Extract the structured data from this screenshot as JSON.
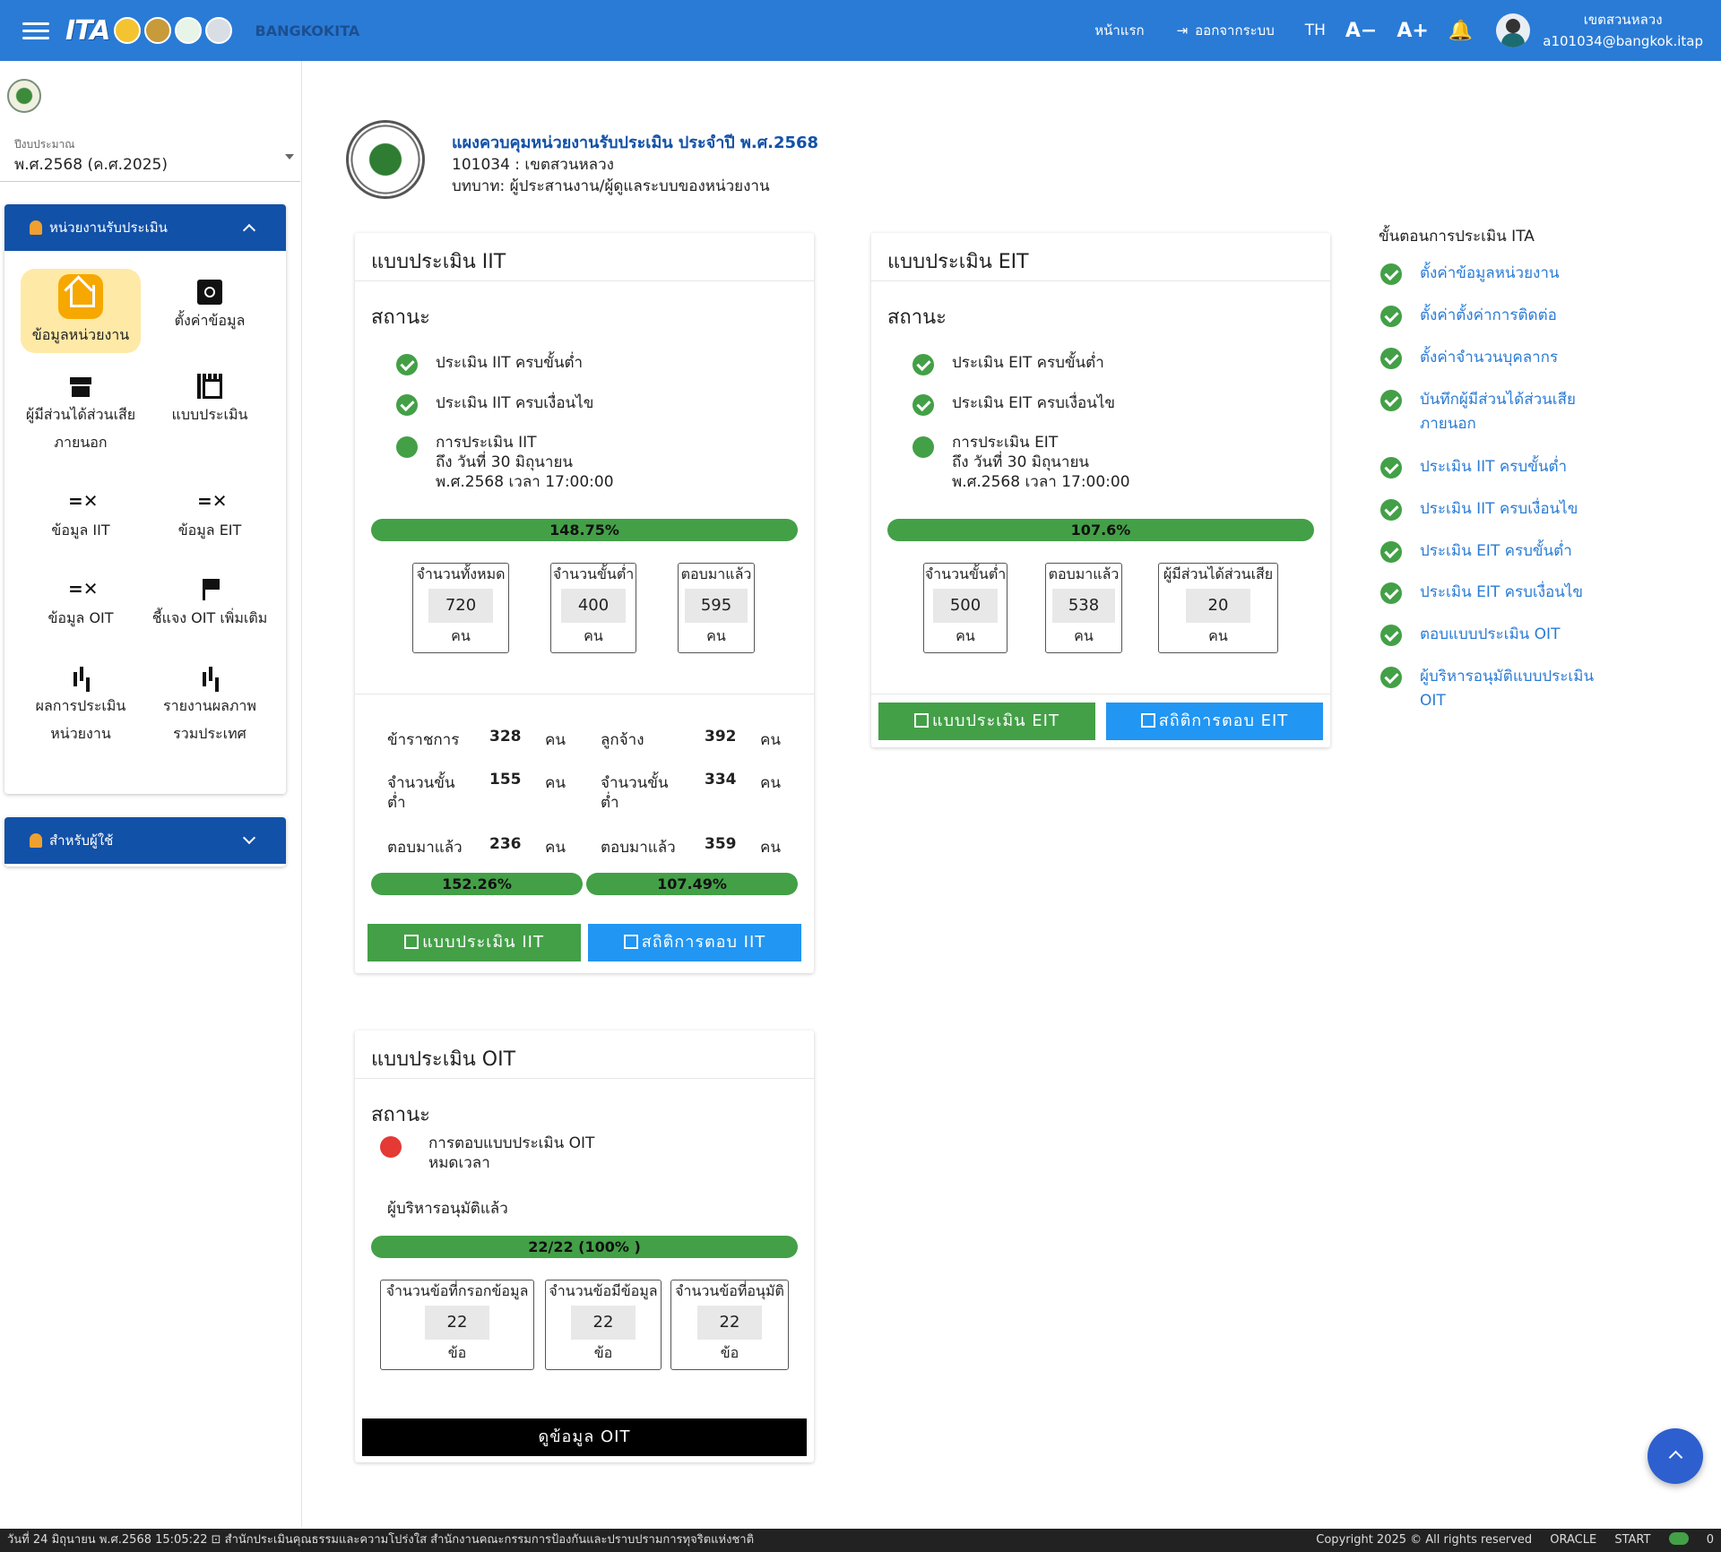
{
  "header": {
    "brand": "BANGKOKITA",
    "home": "หน้าแรก",
    "logout": "ออกจากระบบ",
    "lang": "TH",
    "font_down": "A−",
    "font_up": "A+",
    "user_name": "เขตสวนหลวง",
    "user_email": "a101034@bangkok.itap"
  },
  "sidebar": {
    "budget_label": "ปีงบประมาณ",
    "budget_value": "พ.ศ.2568 (ค.ศ.2025)",
    "panel_title": "หน่วยงานรับประเมิน",
    "items": [
      {
        "line1": "ข้อมูลหน่วยงาน",
        "line2": ""
      },
      {
        "line1": "ตั้งค่าข้อมูล",
        "line2": ""
      },
      {
        "line1": "ผู้มีส่วนได้ส่วนเสีย",
        "line2": "ภายนอก"
      },
      {
        "line1": "แบบประเมิน",
        "line2": ""
      },
      {
        "line1": "ข้อมูล IIT",
        "line2": ""
      },
      {
        "line1": "ข้อมูล EIT",
        "line2": ""
      },
      {
        "line1": "ข้อมูล OIT",
        "line2": ""
      },
      {
        "line1": "ชี้แจง OIT เพิ่มเติม",
        "line2": ""
      },
      {
        "line1": "ผลการประเมิน",
        "line2": "หน่วยงาน"
      },
      {
        "line1": "รายงานผลภาพ",
        "line2": "รวมประเทศ"
      }
    ],
    "user_panel_title": "สำหรับผู้ใช้"
  },
  "org": {
    "title": "แผงควบคุมหน่วยงานรับประเมิน ประจำปี พ.ศ.2568",
    "code": "101034 : เขตสวนหลวง",
    "role": "บทบาท: ผู้ประสานงาน/ผู้ดูแลระบบของหน่วยงาน"
  },
  "iit": {
    "title": "แบบประเมิน IIT",
    "status_label": "สถานะ",
    "s1": "ประเมิน IIT ครบขั้นต่ำ",
    "s2": "ประเมิน IIT ครบเงื่อนไข",
    "s3a": "การประเมิน IIT",
    "s3b": "ถึง วันที่ 30 มิถุนายน",
    "s3c": "พ.ศ.2568 เวลา 17:00:00",
    "progress": "148.75%",
    "boxes": [
      {
        "label": "จำนวนทั้งหมด",
        "value": "720",
        "unit": "คน"
      },
      {
        "label": "จำนวนขั้นต่ำ",
        "value": "400",
        "unit": "คน"
      },
      {
        "label": "ตอบมาแล้ว",
        "value": "595",
        "unit": "คน"
      }
    ],
    "left": {
      "k1": "ข้าราชการ",
      "v1": "328",
      "k2a": "จำนวนขั้น",
      "k2b": "ต่ำ",
      "v2": "155",
      "k3": "ตอบมาแล้ว",
      "v3": "236",
      "unit": "คน",
      "progress": "152.26%"
    },
    "right": {
      "k1": "ลูกจ้าง",
      "v1": "392",
      "k2a": "จำนวนขั้น",
      "k2b": "ต่ำ",
      "v2": "334",
      "k3": "ตอบมาแล้ว",
      "v3": "359",
      "unit": "คน",
      "progress": "107.49%"
    },
    "btn_form": "แบบประเมิน IIT",
    "btn_stats": "สถิติการตอบ IIT"
  },
  "eit": {
    "title": "แบบประเมิน EIT",
    "status_label": "สถานะ",
    "s1": "ประเมิน EIT ครบขั้นต่ำ",
    "s2": "ประเมิน EIT ครบเงื่อนไข",
    "s3a": "การประเมิน EIT",
    "s3b": "ถึง วันที่ 30 มิถุนายน",
    "s3c": "พ.ศ.2568 เวลา 17:00:00",
    "progress": "107.6%",
    "boxes": [
      {
        "label": "จำนวนขั้นต่ำ",
        "value": "500",
        "unit": "คน"
      },
      {
        "label": "ตอบมาแล้ว",
        "value": "538",
        "unit": "คน"
      },
      {
        "label": "ผู้มีส่วนได้ส่วนเสีย",
        "value": "20",
        "unit": "คน"
      }
    ],
    "btn_form": "แบบประเมิน EIT",
    "btn_stats": "สถิติการตอบ EIT"
  },
  "oit": {
    "title": "แบบประเมิน OIT",
    "status_label": "สถานะ",
    "s1a": "การตอบแบบประเมิน OIT",
    "s1b": "หมดเวลา",
    "approved": "ผู้บริหารอนุมัติแล้ว",
    "progress": "22/22 (100% )",
    "boxes": [
      {
        "label": "จำนวนข้อที่กรอกข้อมูล",
        "value": "22",
        "unit": "ข้อ"
      },
      {
        "label": "จำนวนข้อมีข้อมูล",
        "value": "22",
        "unit": "ข้อ"
      },
      {
        "label": "จำนวนข้อที่อนุมัติ",
        "value": "22",
        "unit": "ข้อ"
      }
    ],
    "btn_view": "ดูข้อมูล OIT"
  },
  "steps": {
    "title": "ขั้นตอนการประเมิน ITA",
    "items": [
      {
        "a": "ตั้งค่าข้อมูลหน่วยงาน",
        "b": ""
      },
      {
        "a": "ตั้งค่าตั้งค่าการติดต่อ",
        "b": ""
      },
      {
        "a": "ตั้งค่าจำนวนบุคลากร",
        "b": ""
      },
      {
        "a": "บันทึกผู้มีส่วนได้ส่วนเสีย",
        "b": "ภายนอก"
      },
      {
        "a": "ประเมิน IIT ครบขั้นต่ำ",
        "b": ""
      },
      {
        "a": "ประเมิน IIT ครบเงื่อนไข",
        "b": ""
      },
      {
        "a": "ประเมิน EIT ครบขั้นต่ำ",
        "b": ""
      },
      {
        "a": "ประเมิน EIT ครบเงื่อนไข",
        "b": ""
      },
      {
        "a": "ตอบแบบประเมิน OIT",
        "b": ""
      },
      {
        "a": "ผู้บริหารอนุมัติแบบประเมิน",
        "b": "OIT"
      }
    ]
  },
  "footer": {
    "left": "วันที่ 24 มิถุนายน พ.ศ.2568 15:05:22 ⊡ สำนักประเมินคุณธรรมและความโปร่งใส สำนักงานคณะกรรมการป้องกันและปราบปรามการทุจริตแห่งชาติ",
    "copyright": "Copyright 2025 © All rights reserved",
    "oracle": "ORACLE",
    "start": "START",
    "count": "0"
  },
  "colors": {
    "primary": "#2a7bd6",
    "panel": "#1251a8",
    "success": "#43a047",
    "info": "#2196f3",
    "danger": "#e53935"
  }
}
